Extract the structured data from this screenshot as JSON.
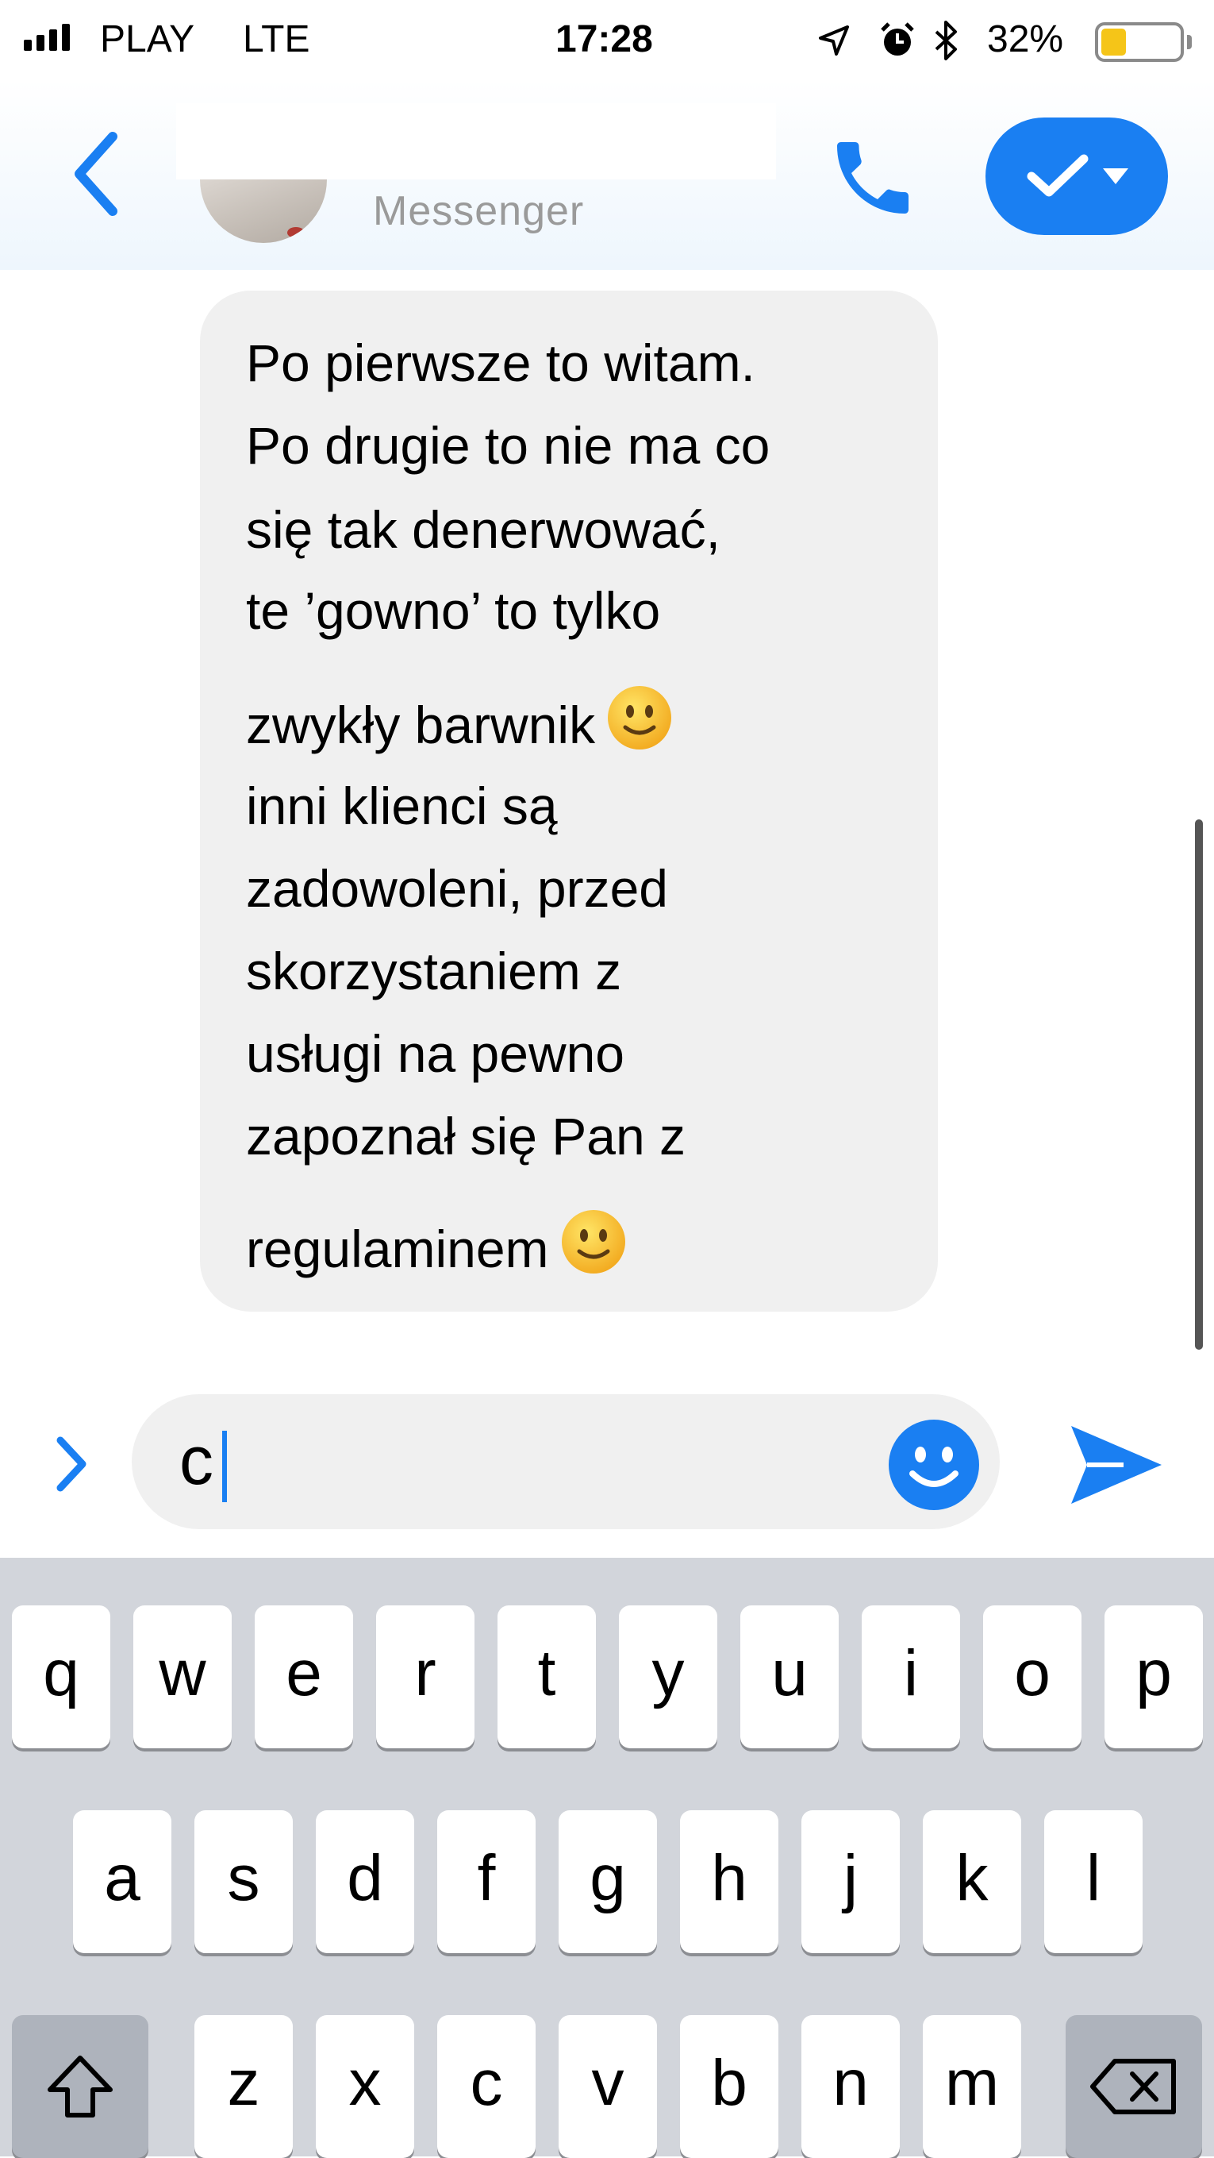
{
  "status_bar": {
    "carrier": "PLAY",
    "network": "LTE",
    "time": "17:28",
    "battery_percent": "32%",
    "battery_level": 0.32,
    "battery_color": "#f5c518",
    "icons": [
      "signal-icon",
      "location-arrow-icon",
      "alarm-icon",
      "bluetooth-icon",
      "battery-icon"
    ]
  },
  "header": {
    "back_icon": "chevron-left-icon",
    "subtitle": "Messenger",
    "call_icon": "phone-icon",
    "action_icon": "checkmark-dropdown-icon"
  },
  "message": {
    "lines": [
      "Po pierwsze to witam.",
      "Po drugie to nie ma co",
      "się tak denerwować,",
      "te ’gowno’ to tylko",
      "zwykły barwnik",
      "inni klienci są",
      "zadowoleni, przed",
      "skorzystaniem z",
      "usługi na pewno",
      "zapoznał się Pan z",
      "regulaminem"
    ],
    "emoji": "slightly-smiling-face-emoji"
  },
  "composer": {
    "expand_icon": "chevron-right-icon",
    "input_value": "c",
    "emoji_icon": "smiley-icon",
    "send_icon": "send-icon"
  },
  "keyboard": {
    "row1": [
      "q",
      "w",
      "e",
      "r",
      "t",
      "y",
      "u",
      "i",
      "o",
      "p"
    ],
    "row2": [
      "a",
      "s",
      "d",
      "f",
      "g",
      "h",
      "j",
      "k",
      "l"
    ],
    "row3": [
      "z",
      "x",
      "c",
      "v",
      "b",
      "n",
      "m"
    ],
    "shift_icon": "shift-icon",
    "backspace_icon": "backspace-icon"
  },
  "colors": {
    "accent": "#1a7ff2",
    "bubble": "#f0f0f0",
    "keyboard_bg": "#d2d5db"
  }
}
